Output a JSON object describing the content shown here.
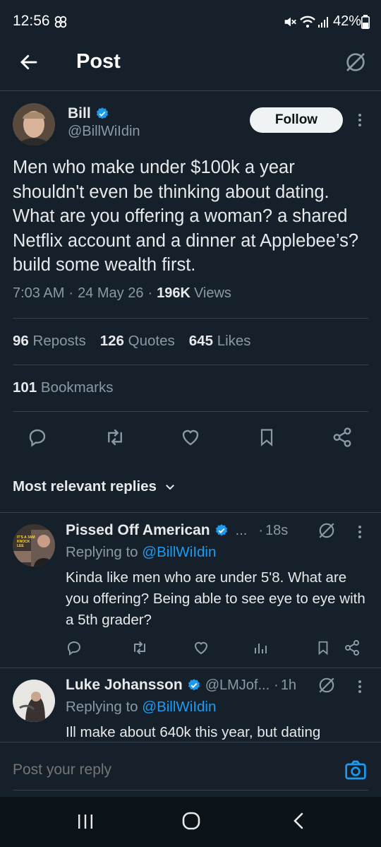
{
  "status_bar": {
    "time": "12:56",
    "battery": "42%"
  },
  "header": {
    "title": "Post"
  },
  "post": {
    "author_name": "Bill",
    "author_handle": "@BillWiIdin",
    "follow_label": "Follow",
    "text": "Men who make under $100k a year shouldn't even be thinking about dating. What are you offering a woman? a shared Netflix account and a dinner at Applebee’s? build some wealth first.",
    "time": "7:03 AM",
    "date": "24 May 26",
    "views_count": "196K",
    "views_label": "Views",
    "reposts_count": "96",
    "reposts_label": "Reposts",
    "quotes_count": "126",
    "quotes_label": "Quotes",
    "likes_count": "645",
    "likes_label": "Likes",
    "bookmarks_count": "101",
    "bookmarks_label": "Bookmarks"
  },
  "replies_filter": {
    "label": "Most relevant replies"
  },
  "replies": [
    {
      "name": "Pissed Off American",
      "ellipsis": "...",
      "time": "18s",
      "replying_prefix": "Replying to",
      "replying_handle": "@BillWiIdin",
      "text": "Kinda like men who are under 5'8. What are you offering? Being able to see eye to eye with a 5th grader?",
      "avatar_text": "IT'S A 3AM KNOCK LEE"
    },
    {
      "name": "Luke Johansson",
      "handle": "@LMJof...",
      "time": "1h",
      "replying_prefix": "Replying to",
      "replying_handle": "@BillWiIdin",
      "text": "Ill make about 640k this year, but dating"
    }
  ],
  "composer": {
    "placeholder": "Post your reply"
  },
  "colors": {
    "background": "#15202b",
    "accent": "#1d9bf0",
    "muted": "#8b98a5",
    "divider": "#38444d"
  }
}
